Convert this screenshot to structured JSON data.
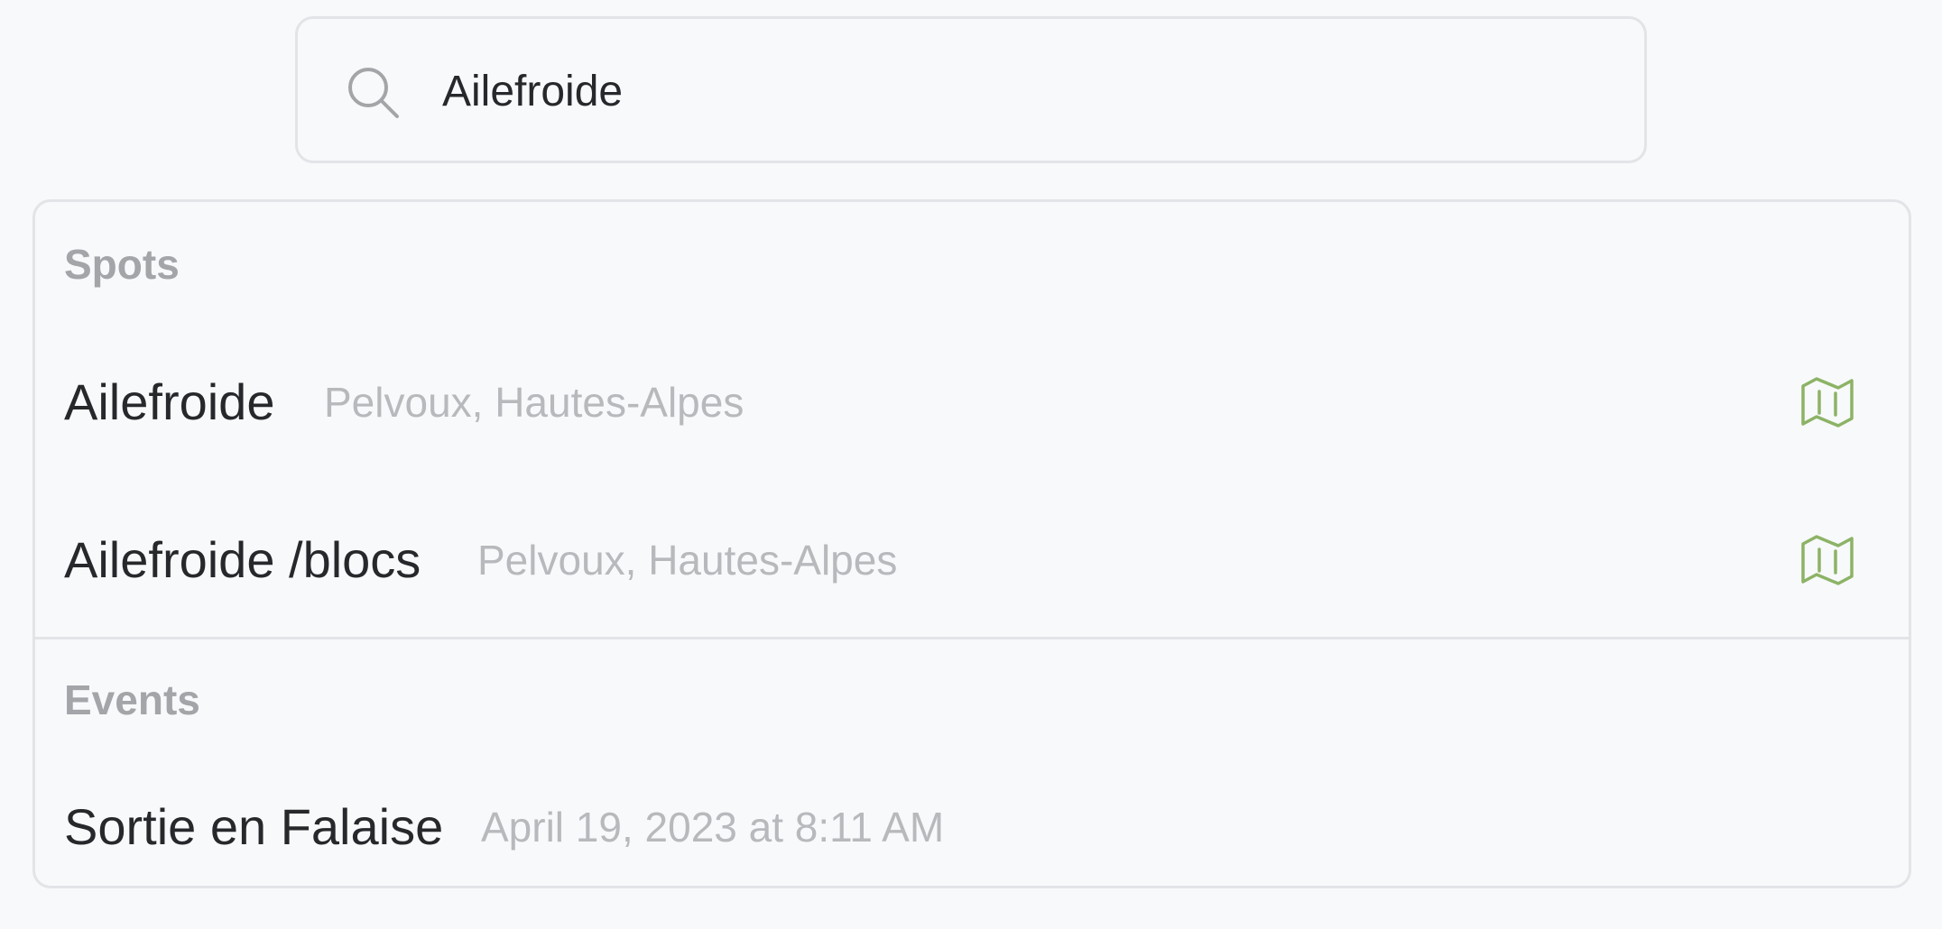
{
  "search": {
    "value": "Ailefroide",
    "icon": "search-icon"
  },
  "sections": {
    "spots": {
      "title": "Spots",
      "items": [
        {
          "name": "Ailefroide",
          "location": "Pelvoux, Hautes-Alpes",
          "icon": "map-icon"
        },
        {
          "name": "Ailefroide /blocs",
          "location": "Pelvoux, Hautes-Alpes",
          "icon": "map-icon"
        }
      ]
    },
    "events": {
      "title": "Events",
      "items": [
        {
          "name": "Sortie en Falaise",
          "date": "April 19, 2023 at 8:11 AM"
        }
      ]
    }
  },
  "colors": {
    "background": "#f8f9fa",
    "border": "#e2e4e7",
    "text": "#26282b",
    "muted_text": "#b7b9bc",
    "section_title": "#a3a5a8",
    "map_icon": "#8cb366"
  }
}
